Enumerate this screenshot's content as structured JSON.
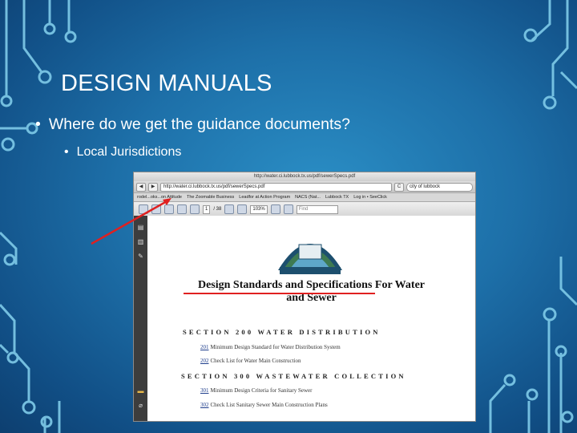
{
  "slide": {
    "title": "DESIGN MANUALS",
    "bullet_level1": "Where do we get the guidance documents?",
    "bullet_level2": "Local Jurisdictions",
    "bullet_glyph": "•"
  },
  "browser": {
    "window_title": "http://water.ci.lubbock.tx.us/pdf/sewerSpecs.pdf",
    "back_label": "◀",
    "forward_label": "▶",
    "url": "http://water.ci.lubbock.tx.us/pdf/sewerSpecs.pdf",
    "reload_label": "C",
    "search_value": "city of lubbock",
    "bookmarks": [
      "rodel...oks...on Attitude",
      "The Zoomable Business",
      "Leadfor at Action Program",
      "NACS (Nat...",
      "Lubbock TX",
      "Log in • SeeClick"
    ],
    "pdf_toolbar": {
      "page_number": "1",
      "page_total": "/ 38",
      "zoom": "103%",
      "find_placeholder": "Find"
    }
  },
  "document": {
    "logo_text_top": "CITY OF",
    "logo_text_main": "LUBBOCK",
    "logo_text_bottom": "WATER UTILITIES",
    "heading_line1": "Design Standards and Specifications For Water",
    "heading_line2": "and Sewer",
    "section1": "SECTION 200 WATER DISTRIBUTION",
    "items1": [
      {
        "num": "201",
        "text": "Minimum Design Standard for Water Distribution System"
      },
      {
        "num": "202",
        "text": "Check List for Water Main Construction"
      }
    ],
    "section2": "SECTION 300 WASTEWATER COLLECTION",
    "items2": [
      {
        "num": "301",
        "text": "Minimum Design Criteria for Sanitary Sewer"
      },
      {
        "num": "302",
        "text": "Check List Sanitary Sewer Main Construction Plans"
      }
    ]
  },
  "colors": {
    "annotation_red": "#e02020",
    "link_blue": "#1f3e8c",
    "circuit": "#8fd3ef"
  }
}
